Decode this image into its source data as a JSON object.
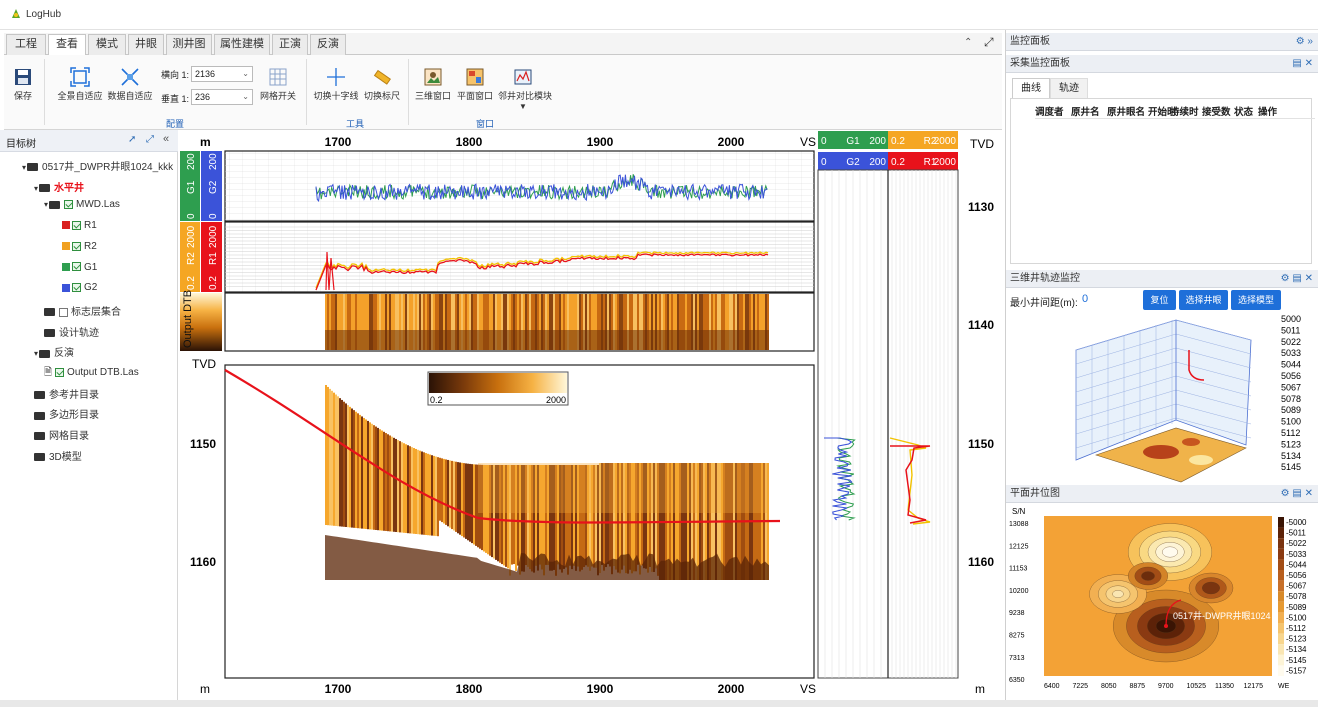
{
  "app": {
    "title": "LogHub"
  },
  "tabs": [
    "工程",
    "查看",
    "模式",
    "井眼",
    "测井图",
    "属性建模",
    "正演",
    "反演"
  ],
  "active_tab": 1,
  "ribbon": {
    "save": "保存",
    "fit_all": "全景自适应",
    "fit_data": "数据自适应",
    "h_label": "横向 1:",
    "h_value": "2136",
    "v_label": "垂直 1:",
    "v_value": "236",
    "grid_toggle": "网格开关",
    "group_config": "配置",
    "crosshair": "切换十字线",
    "ruler": "切换标尺",
    "group_tools": "工具",
    "view3d": "三维窗口",
    "view2d": "平面窗口",
    "compare": "邻井对比模块",
    "group_window": "窗口"
  },
  "tree": {
    "title": "目标树",
    "items": [
      {
        "label": "0517井_DWPR井眼1024_kkk",
        "level": 0,
        "kind": "root"
      },
      {
        "label": "水平井",
        "level": 1,
        "kind": "well"
      },
      {
        "label": "MWD.Las",
        "level": 2,
        "kind": "las"
      },
      {
        "label": "R1",
        "level": 3,
        "kind": "curve",
        "color": "#d92020"
      },
      {
        "label": "R2",
        "level": 3,
        "kind": "curve",
        "color": "#f0a020"
      },
      {
        "label": "G1",
        "level": 3,
        "kind": "curve",
        "color": "#2e9e4f"
      },
      {
        "label": "G2",
        "level": 3,
        "kind": "curve",
        "color": "#3b53d9"
      },
      {
        "label": "标志层集合",
        "level": 2,
        "kind": "folder-check"
      },
      {
        "label": "设计轨迹",
        "level": 2,
        "kind": "folder"
      },
      {
        "label": "反演",
        "level": 1,
        "kind": "open-folder"
      },
      {
        "label": "Output DTB.Las",
        "level": 2,
        "kind": "file-check"
      },
      {
        "label": "参考井目录",
        "level": 1,
        "kind": "folder"
      },
      {
        "label": "多边形目录",
        "level": 1,
        "kind": "folder"
      },
      {
        "label": "网格目录",
        "level": 1,
        "kind": "folder"
      },
      {
        "label": "3D模型",
        "level": 1,
        "kind": "folder"
      }
    ]
  },
  "section": {
    "x_unit": "m",
    "x_axis_right": "VS",
    "y_axis_label": "TVD",
    "x_ticks": [
      "1700",
      "1800",
      "1900",
      "2000"
    ],
    "y_ticks_main": [
      "1150",
      "1160"
    ],
    "track_labels": {
      "g1": "G1",
      "g1_min": "0",
      "g1_max": "200",
      "g2": "G2",
      "g2_min": "0",
      "g2_max": "200",
      "r2": "R2",
      "r2_min": "0.2",
      "r2_max": "2000",
      "r1": "R1",
      "r1_min": "0.2",
      "r1_max": "2000",
      "dtb": "Output DTB"
    },
    "colorbar_min": "0.2",
    "colorbar_max": "2000"
  },
  "logtrack": {
    "h1": [
      "0",
      "G1",
      "200",
      "0.2",
      "R2",
      "2000"
    ],
    "h2": [
      "0",
      "G2",
      "200",
      "0.2",
      "R1",
      "2000"
    ],
    "tvd_label": "TVD",
    "tvd_ticks": [
      "1130",
      "1140",
      "1150",
      "1160"
    ],
    "unit": "m"
  },
  "right": {
    "monitor_title": "监控面板",
    "acq_title": "采集监控面板",
    "subtabs": [
      "曲线",
      "轨迹"
    ],
    "columns": [
      "调度者",
      "原井名",
      "原井眼名",
      "开始时",
      "持续时",
      "接受数",
      "状态",
      "操作"
    ],
    "traj_title": "三维井轨迹监控",
    "min_dist_label": "最小井间距(m):",
    "min_dist_value": "0",
    "btn_reset": "复位",
    "btn_pick_well": "选择井眼",
    "btn_pick_model": "选择模型",
    "depth_scale": [
      "5000",
      "5011",
      "5022",
      "5033",
      "5044",
      "5056",
      "5067",
      "5078",
      "5089",
      "5100",
      "5112",
      "5123",
      "5134",
      "5145"
    ],
    "plan_title": "平面井位图",
    "plan_y_label": "S/N",
    "plan_y_ticks": [
      "13088",
      "12125",
      "11153",
      "10200",
      "9238",
      "8275",
      "7313",
      "6350"
    ],
    "plan_x_ticks": [
      "6400",
      "7225",
      "8050",
      "8875",
      "9700",
      "10525",
      "11350",
      "12175"
    ],
    "plan_x_label": "WE",
    "plan_legend": [
      "-5000",
      "-5011",
      "-5022",
      "-5033",
      "-5044",
      "-5056",
      "-5067",
      "-5078",
      "-5089",
      "-5100",
      "-5112",
      "-5123",
      "-5134",
      "-5145",
      "-5157"
    ],
    "plan_well_label": "0517井-DWPR井眼1024"
  },
  "colors": {
    "accent": "#1e6fd9",
    "red": "#e8121b",
    "orange": "#f5a623",
    "green": "#2e9e4f",
    "blue": "#3b53d9"
  }
}
